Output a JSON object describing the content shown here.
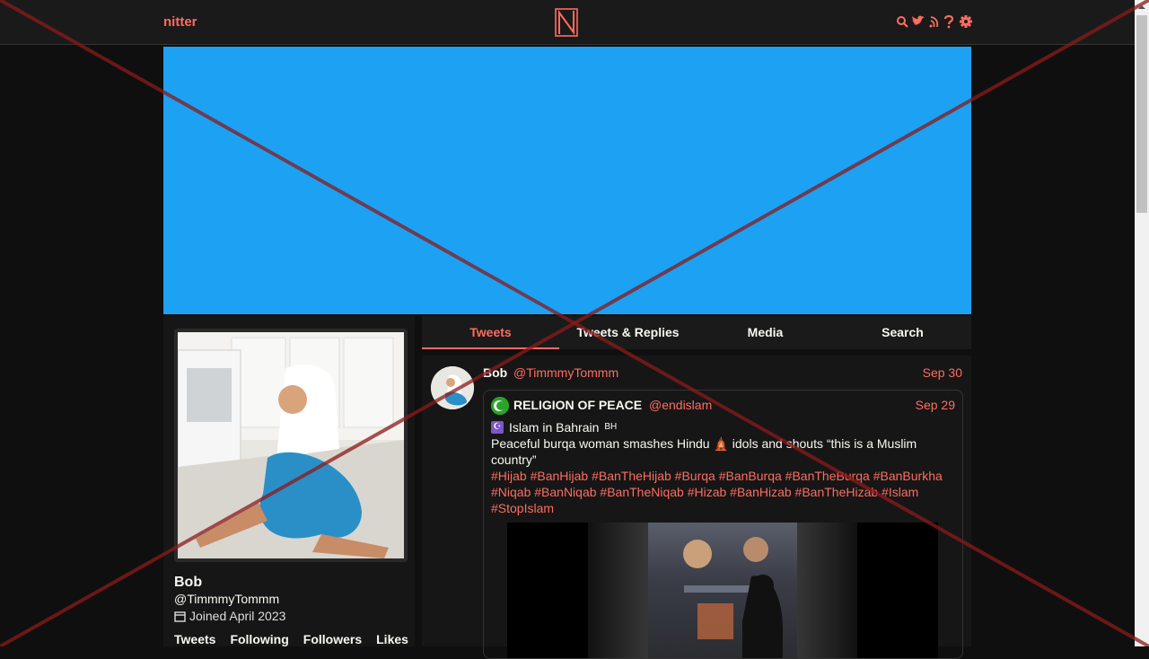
{
  "navbar": {
    "brand": "nitter",
    "logo_letter": "N",
    "icons": [
      "search-icon",
      "twitter-bird-icon",
      "rss-icon",
      "help-icon",
      "gear-icon"
    ]
  },
  "colors": {
    "accent": "#ff6c60",
    "banner": "#1da1f2",
    "background": "#0f0f0f",
    "panel": "#161616"
  },
  "profile": {
    "fullname": "Bob",
    "username": "@TimmmyTommm",
    "joined": "Joined April 2023",
    "stats": [
      "Tweets",
      "Following",
      "Followers",
      "Likes"
    ]
  },
  "tabs": [
    {
      "label": "Tweets",
      "active": true
    },
    {
      "label": "Tweets & Replies",
      "active": false
    },
    {
      "label": "Media",
      "active": false
    },
    {
      "label": "Search",
      "active": false
    }
  ],
  "tweet": {
    "fullname": "Bob",
    "username": "@TimmmyTommm",
    "date": "Sep 30",
    "quote": {
      "fullname": "RELIGION OF PEACE",
      "username": "@endislam",
      "date": "Sep 29",
      "line1": "Islam in Bahrain",
      "flag": "BH",
      "text": "Peaceful burqa woman smashes Hindu 🛕 idols and shouts “this is a Muslim country”",
      "hashtags": "#Hijab #BanHijab #BanTheHijab #Burqa #BanBurqa #BanTheBurqa #BanBurkha #Niqab #BanNiqab #BanTheNiqab #Hizab #BanHizab #BanTheHizab #Islam #StopIslam"
    }
  }
}
